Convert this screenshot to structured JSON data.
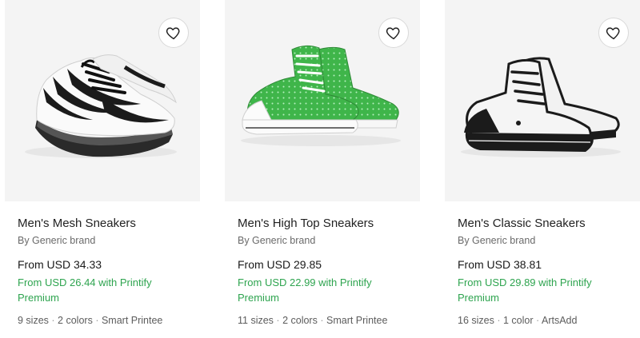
{
  "products": [
    {
      "title": "Men's Mesh Sneakers",
      "brand": "By Generic brand",
      "price": "From USD 34.33",
      "promo": "From USD 26.44 with Printify Premium",
      "sizes": "9 sizes",
      "colors": "2 colors",
      "seller": "Smart Printee",
      "favorite_icon": "heart-outline-icon",
      "image": "white-black-mesh-sneaker"
    },
    {
      "title": "Men's High Top Sneakers",
      "brand": "By Generic brand",
      "price": "From USD 29.85",
      "promo": "From USD 22.99 with Printify Premium",
      "sizes": "11 sizes",
      "colors": "2 colors",
      "seller": "Smart Printee",
      "favorite_icon": "heart-outline-icon",
      "image": "green-dotted-high-top-sneaker"
    },
    {
      "title": "Men's Classic Sneakers",
      "brand": "By Generic brand",
      "price": "From USD 38.81",
      "promo": "From USD 29.89 with Printify Premium",
      "sizes": "16 sizes",
      "colors": "1 color",
      "seller": "ArtsAdd",
      "favorite_icon": "heart-outline-icon",
      "image": "white-black-classic-high-top-sneaker"
    }
  ],
  "meta_separator": "·",
  "colors": {
    "promo_green": "#2ea44f",
    "card_background": "#f4f4f4",
    "shoe_green": "#3fb54a"
  }
}
